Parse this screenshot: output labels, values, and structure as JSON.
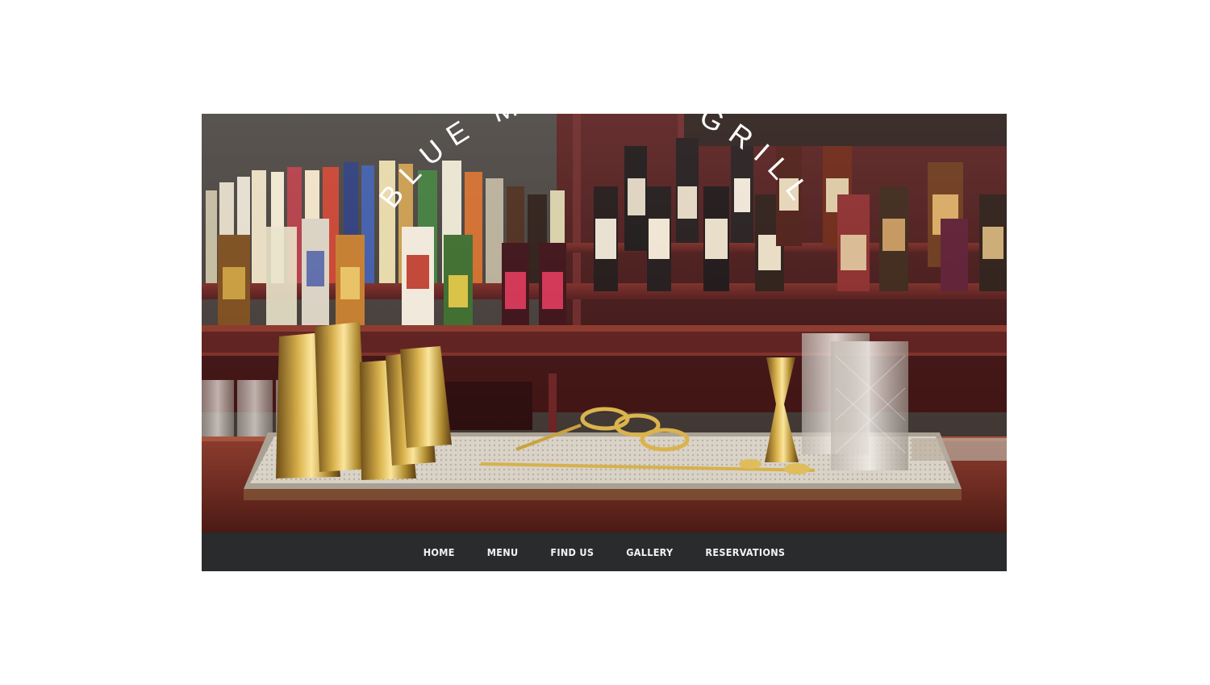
{
  "site": {
    "logo_text": "BLUE MONKEY GRILL"
  },
  "hero": {
    "image_subject": "bar counter with liquor bottles and brass cocktail tools"
  },
  "nav": {
    "items": [
      {
        "label": "HOME"
      },
      {
        "label": "MENU"
      },
      {
        "label": "FIND US"
      },
      {
        "label": "GALLERY"
      },
      {
        "label": "RESERVATIONS"
      }
    ]
  },
  "colors": {
    "nav_background": "#2a2b2c",
    "nav_text": "#f2f2f2",
    "logo_text": "#ffffff",
    "page_background": "#ffffff"
  }
}
